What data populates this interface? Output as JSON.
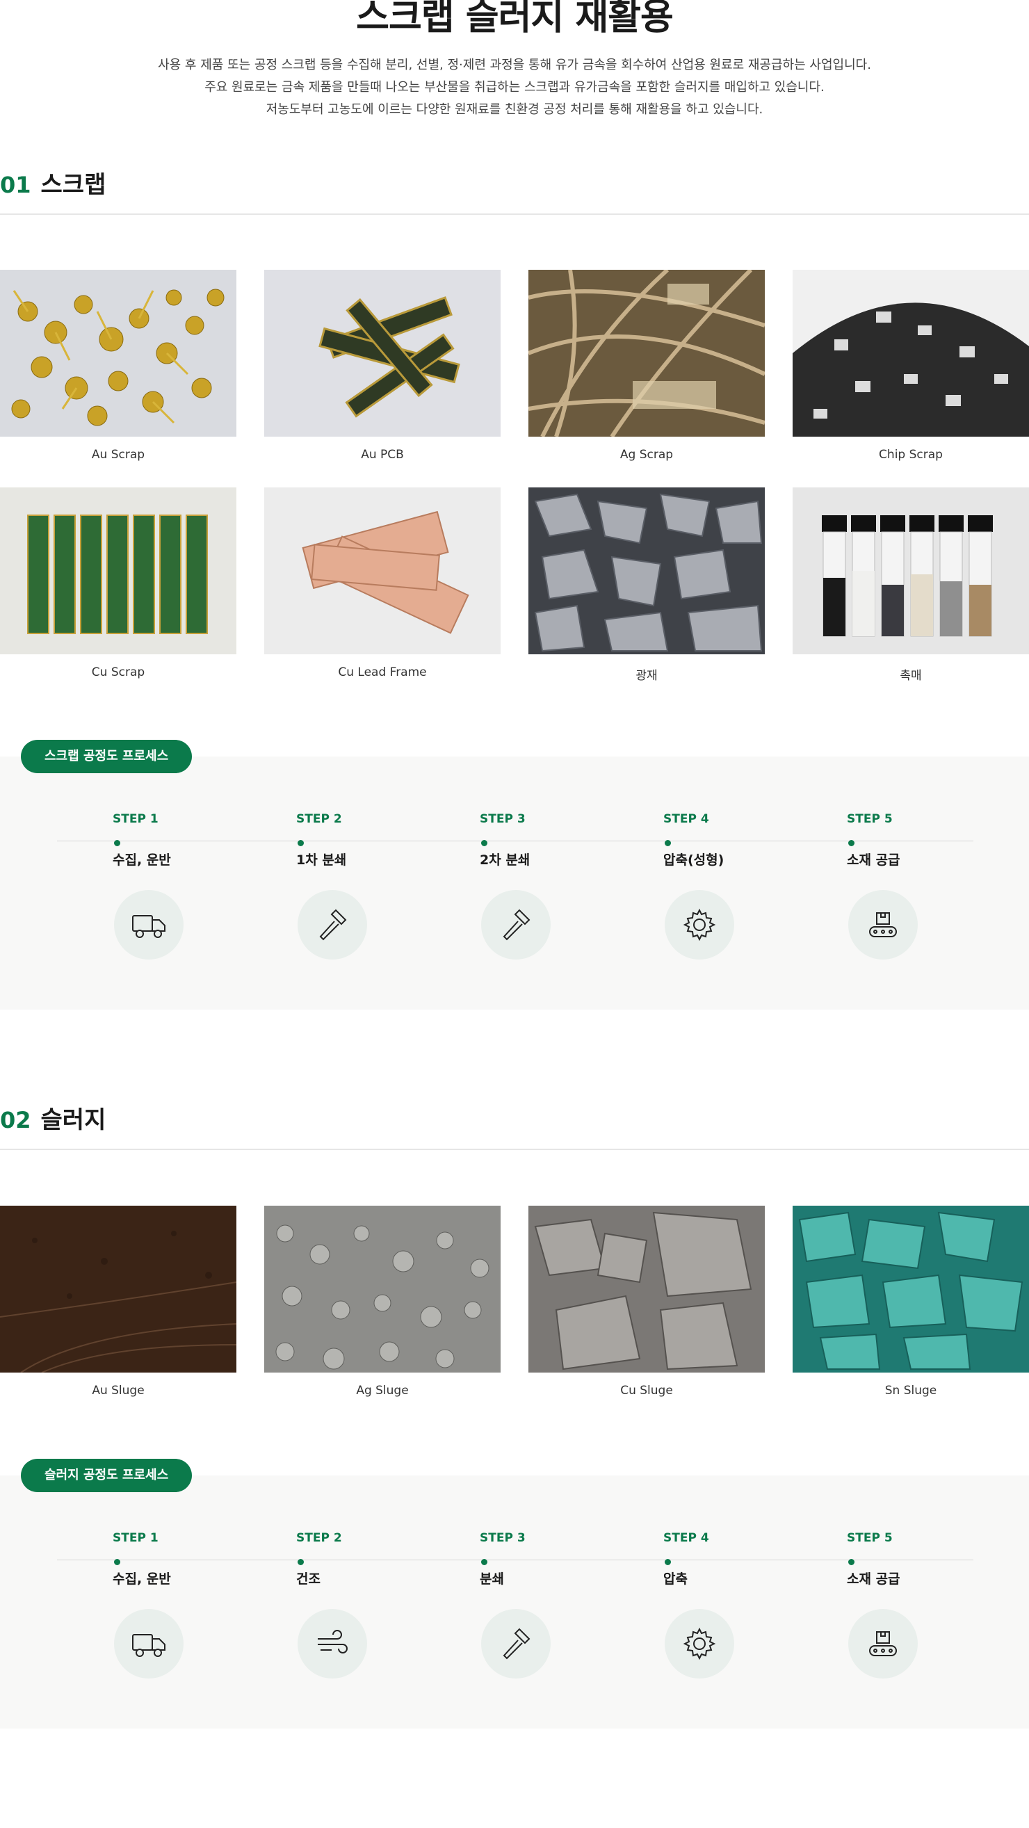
{
  "page": {
    "title": "스크랩 슬러지 재활용",
    "intro": [
      "사용 후 제품 또는 공정 스크랩 등을 수집해 분리, 선별, 정·제련 과정을 통해 유가 금속을 회수하여 산업용 원료로 재공급하는 사업입니다.",
      "주요 원료로는 금속 제품을 만들때 나오는 부산물을 취급하는 스크랩과 유가금속을 포함한 슬러지를 매입하고 있습니다.",
      "저농도부터 고농도에 이르는 다양한 원재료를 친환경 공정 처리를 통해 재활용을 하고 있습니다."
    ]
  },
  "scrap": {
    "num": "01",
    "title": "스크랩",
    "items": [
      {
        "label": "Au Scrap",
        "icon": "gold-pins-photo"
      },
      {
        "label": "Au PCB",
        "icon": "pcb-strips-photo"
      },
      {
        "label": "Ag Scrap",
        "icon": "silver-frames-photo"
      },
      {
        "label": "Chip Scrap",
        "icon": "chip-pile-photo"
      },
      {
        "label": "Cu Scrap",
        "icon": "green-pcb-photo"
      },
      {
        "label": "Cu Lead Frame",
        "icon": "copper-frame-photo"
      },
      {
        "label": "광재",
        "icon": "slag-photo"
      },
      {
        "label": "촉매",
        "icon": "catalyst-vials-photo"
      }
    ],
    "process_label": "스크랩 공정도 프로세스",
    "steps": [
      {
        "step": "STEP 1",
        "name": "수집, 운반",
        "icon": "truck-icon"
      },
      {
        "step": "STEP 2",
        "name": "1차 분쇄",
        "icon": "hammer-icon"
      },
      {
        "step": "STEP 3",
        "name": "2차 분쇄",
        "icon": "hammer-icon"
      },
      {
        "step": "STEP 4",
        "name": "압축(성형)",
        "icon": "gear-icon"
      },
      {
        "step": "STEP 5",
        "name": "소재 공급",
        "icon": "conveyor-icon"
      }
    ]
  },
  "sludge": {
    "num": "02",
    "title": "슬러지",
    "items": [
      {
        "label": "Au Sluge",
        "icon": "brown-soil-photo"
      },
      {
        "label": "Ag Sluge",
        "icon": "gray-gravel-photo"
      },
      {
        "label": "Cu Sluge",
        "icon": "gray-rock-photo"
      },
      {
        "label": "Sn Sluge",
        "icon": "teal-crystal-photo"
      }
    ],
    "process_label": "슬러지 공정도 프로세스",
    "steps": [
      {
        "step": "STEP 1",
        "name": "수집, 운반",
        "icon": "truck-icon"
      },
      {
        "step": "STEP 2",
        "name": "건조",
        "icon": "wind-icon"
      },
      {
        "step": "STEP 3",
        "name": "분쇄",
        "icon": "hammer-icon"
      },
      {
        "step": "STEP 4",
        "name": "압축",
        "icon": "gear-icon"
      },
      {
        "step": "STEP 5",
        "name": "소재 공급",
        "icon": "conveyor-icon"
      }
    ]
  },
  "colors": {
    "accent": "#0b7a4b",
    "process_bg": "#f8f8f7",
    "icon_bg": "#e9efec"
  }
}
